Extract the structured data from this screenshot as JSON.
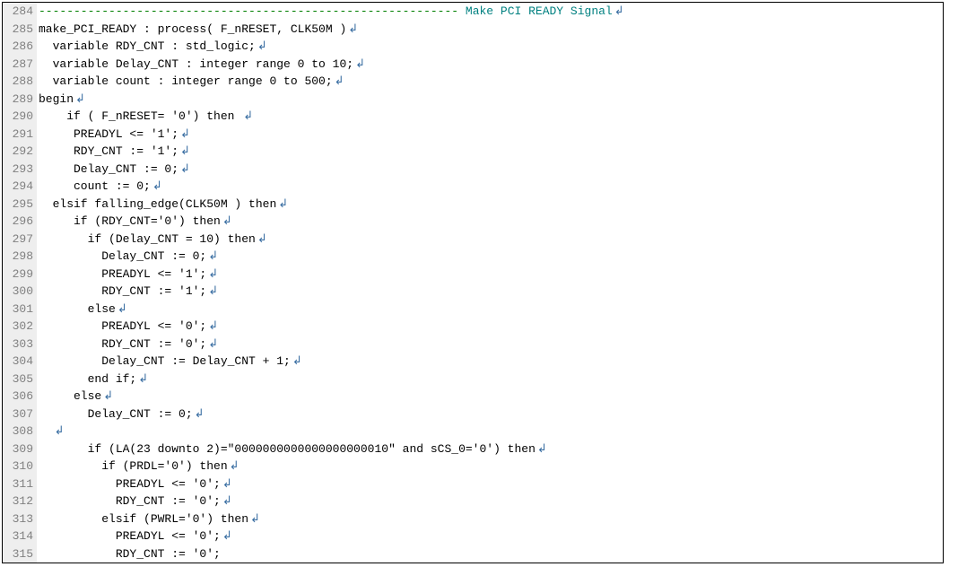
{
  "eol_glyph": "↲",
  "lines": [
    {
      "num": "284",
      "segments": [
        {
          "cls": "comment-dash",
          "text": "------------------------------------------------------------ "
        },
        {
          "cls": "label-pci",
          "text": "Make PCI READY Signal"
        }
      ]
    },
    {
      "num": "285",
      "segments": [
        {
          "cls": "plain",
          "text": "make_PCI_READY : process( F_nRESET, CLK50M )"
        }
      ]
    },
    {
      "num": "286",
      "segments": [
        {
          "cls": "plain",
          "text": "  variable RDY_CNT : std_logic;"
        }
      ]
    },
    {
      "num": "287",
      "segments": [
        {
          "cls": "plain",
          "text": "  variable Delay_CNT : integer range 0 to 10;"
        }
      ]
    },
    {
      "num": "288",
      "segments": [
        {
          "cls": "plain",
          "text": "  variable count : integer range 0 to 500;"
        }
      ]
    },
    {
      "num": "289",
      "segments": [
        {
          "cls": "plain",
          "text": "begin"
        }
      ]
    },
    {
      "num": "290",
      "segments": [
        {
          "cls": "plain",
          "text": "    if ( F_nRESET= '0') then "
        }
      ]
    },
    {
      "num": "291",
      "segments": [
        {
          "cls": "plain",
          "text": "     PREADYL <= '1';"
        }
      ]
    },
    {
      "num": "292",
      "segments": [
        {
          "cls": "plain",
          "text": "     RDY_CNT := '1';"
        }
      ]
    },
    {
      "num": "293",
      "segments": [
        {
          "cls": "plain",
          "text": "     Delay_CNT := 0;"
        }
      ]
    },
    {
      "num": "294",
      "segments": [
        {
          "cls": "plain",
          "text": "     count := 0;"
        }
      ]
    },
    {
      "num": "295",
      "segments": [
        {
          "cls": "plain",
          "text": "  elsif falling_edge(CLK50M ) then"
        }
      ]
    },
    {
      "num": "296",
      "segments": [
        {
          "cls": "plain",
          "text": "     if (RDY_CNT='0') then"
        }
      ]
    },
    {
      "num": "297",
      "segments": [
        {
          "cls": "plain",
          "text": "       if (Delay_CNT = 10) then"
        }
      ]
    },
    {
      "num": "298",
      "segments": [
        {
          "cls": "plain",
          "text": "         Delay_CNT := 0;"
        }
      ]
    },
    {
      "num": "299",
      "segments": [
        {
          "cls": "plain",
          "text": "         PREADYL <= '1';"
        }
      ]
    },
    {
      "num": "300",
      "segments": [
        {
          "cls": "plain",
          "text": "         RDY_CNT := '1';"
        }
      ]
    },
    {
      "num": "301",
      "segments": [
        {
          "cls": "plain",
          "text": "       else"
        }
      ]
    },
    {
      "num": "302",
      "segments": [
        {
          "cls": "plain",
          "text": "         PREADYL <= '0';"
        }
      ]
    },
    {
      "num": "303",
      "segments": [
        {
          "cls": "plain",
          "text": "         RDY_CNT := '0';"
        }
      ]
    },
    {
      "num": "304",
      "segments": [
        {
          "cls": "plain",
          "text": "         Delay_CNT := Delay_CNT + 1;"
        }
      ]
    },
    {
      "num": "305",
      "segments": [
        {
          "cls": "plain",
          "text": "       end if;"
        }
      ]
    },
    {
      "num": "306",
      "segments": [
        {
          "cls": "plain",
          "text": "     else"
        }
      ]
    },
    {
      "num": "307",
      "segments": [
        {
          "cls": "plain",
          "text": "       Delay_CNT := 0;"
        }
      ]
    },
    {
      "num": "308",
      "segments": [
        {
          "cls": "plain",
          "text": "  "
        }
      ]
    },
    {
      "num": "309",
      "segments": [
        {
          "cls": "plain",
          "text": "       if (LA(23 downto 2)=\"0000000000000000000010\" and sCS_0='0') then"
        }
      ]
    },
    {
      "num": "310",
      "segments": [
        {
          "cls": "plain",
          "text": "         if (PRDL='0') then"
        }
      ]
    },
    {
      "num": "311",
      "segments": [
        {
          "cls": "plain",
          "text": "           PREADYL <= '0';"
        }
      ]
    },
    {
      "num": "312",
      "segments": [
        {
          "cls": "plain",
          "text": "           RDY_CNT := '0';"
        }
      ]
    },
    {
      "num": "313",
      "segments": [
        {
          "cls": "plain",
          "text": "         elsif (PWRL='0') then"
        }
      ]
    },
    {
      "num": "314",
      "segments": [
        {
          "cls": "plain",
          "text": "           PREADYL <= '0';"
        }
      ]
    },
    {
      "num": "315",
      "segments": [
        {
          "cls": "plain",
          "text": "           RDY_CNT := '0';"
        }
      ],
      "no_eol": true
    }
  ]
}
